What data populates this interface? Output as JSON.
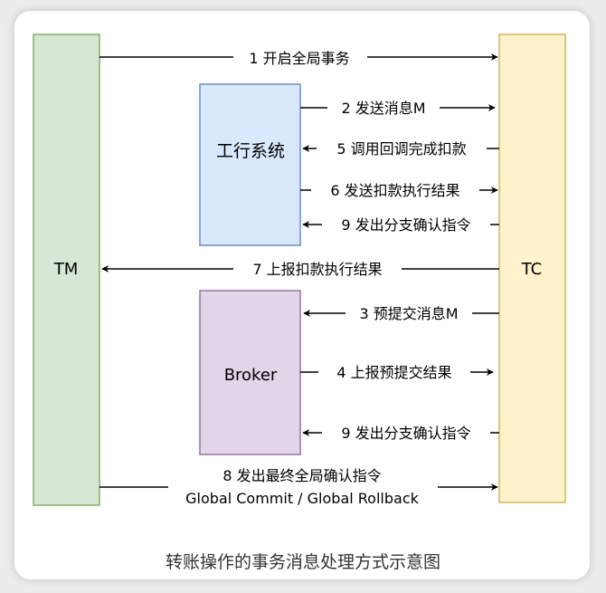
{
  "diagram": {
    "nodes": {
      "tm": {
        "label": "TM",
        "fill": "#d5e8d4",
        "stroke": "#82b366"
      },
      "tc": {
        "label": "TC",
        "fill": "#fff2cc",
        "stroke": "#d6b656"
      },
      "icbc": {
        "label": "工行系统",
        "fill": "#dae8fc",
        "stroke": "#6c8ebf"
      },
      "broker": {
        "label": "Broker",
        "fill": "#e1d5e7",
        "stroke": "#9673a6"
      }
    },
    "edges": {
      "e1": "1 开启全局事务",
      "e2": "2 发送消息M",
      "e5": "5 调用回调完成扣款",
      "e6": "6 发送扣款执行结果",
      "e9a": "9 发出分支确认指令",
      "e7": "7 上报扣款执行结果",
      "e3": "3 预提交消息M",
      "e4": "4 上报预提交结果",
      "e9b": "9 发出分支确认指令",
      "e8_line1": "8 发出最终全局确认指令",
      "e8_line2": "Global Commit / Global Rollback"
    }
  },
  "caption": "转账操作的事务消息处理方式示意图"
}
